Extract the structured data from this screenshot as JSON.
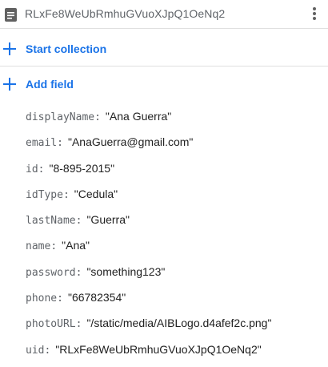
{
  "document": {
    "id": "RLxFe8WeUbRmhuGVuoXJpQ1OeNq2",
    "icon": "document-icon",
    "menu_icon": "more-vert-icon"
  },
  "actions": {
    "start_collection": "Start collection",
    "add_field": "Add field"
  },
  "fields": [
    {
      "key": "displayName",
      "value": "\"Ana Guerra\""
    },
    {
      "key": "email",
      "value": "\"AnaGuerra@gmail.com\""
    },
    {
      "key": "id",
      "value": "\"8-895-2015\""
    },
    {
      "key": "idType",
      "value": "\"Cedula\""
    },
    {
      "key": "lastName",
      "value": "\"Guerra\""
    },
    {
      "key": "name",
      "value": "\"Ana\""
    },
    {
      "key": "password",
      "value": "\"something123\""
    },
    {
      "key": "phone",
      "value": "\"66782354\""
    },
    {
      "key": "photoURL",
      "value": "\"/static/media/AIBLogo.d4afef2c.png\""
    },
    {
      "key": "uid",
      "value": "\"RLxFe8WeUbRmhuGVuoXJpQ1OeNq2\""
    }
  ],
  "colors": {
    "accent": "#1a73e8",
    "key_text": "#5f6368",
    "value_text": "#212121"
  }
}
